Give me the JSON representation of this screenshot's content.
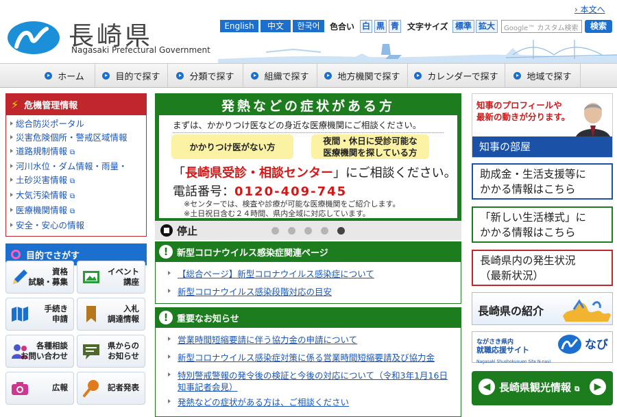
{
  "header": {
    "logo_jp": "長崎県",
    "logo_en": "Nagasaki Prefectural Government",
    "english_link": "本文へ",
    "lang_buttons": [
      "English",
      "中文",
      "한국어"
    ],
    "color_label": "色合い",
    "color_buttons": [
      "白",
      "黒",
      "青"
    ],
    "size_label": "文字サイズ",
    "size_buttons": [
      "標準",
      "拡大"
    ],
    "search_placeholder": "Google™ カスタム検索",
    "search_button": "検索",
    "accent": "#1b6fce"
  },
  "nav": [
    "ホーム",
    "目的で探す",
    "分類で探す",
    "組織で探す",
    "地方機関で探す",
    "カレンダーで探す",
    "地域で探す"
  ],
  "crisis": {
    "title": "危機管理情報",
    "items": [
      "総合防災ポータル",
      "災害危険個所・警戒区域情報",
      "道路規制情報",
      "河川水位・ダム情報・雨量・",
      "土砂災害情報",
      "大気汚染情報",
      "医療機関情報",
      "安全・安心の情報"
    ],
    "color": "#c0272d"
  },
  "purpose": {
    "title": "目的でさがす",
    "buttons": [
      [
        "資格",
        "試験・募集"
      ],
      [
        "イベント",
        "講座"
      ],
      [
        "手続き",
        "申請"
      ],
      [
        "入札",
        "調達情報"
      ],
      [
        "各種相談",
        "お問い合わせ"
      ],
      [
        "県からの",
        "お知らせ"
      ],
      [
        "広報"
      ],
      [
        "記者発表"
      ]
    ]
  },
  "banner": {
    "title": "発熱などの症状がある方",
    "line1": "まずは、かかりつけ医などの身近な医療機関にご相談ください。",
    "box1": "かかりつけ医がない方",
    "box2a": "夜間・休日に受診可能な",
    "box2b": "医療機関を探している方",
    "center_open": "「",
    "center_name": "長崎県受診・相談センター",
    "center_rest": "」にご相談ください。",
    "tel_label": "電話番号：",
    "tel_number": "0120-409-745",
    "note1": "※センターでは、検査や診療が可能な医療機関をご紹介します。",
    "note2": "※土日祝日含む２４時間、県内全域に対応しています。",
    "color": "#1d7d1e"
  },
  "slider": {
    "stop_label": "停止",
    "dots": 5,
    "active_dot": 4
  },
  "covid": {
    "title": "新型コロナウイルス感染症関連ページ",
    "items": [
      "【総合ページ】新型コロナウイルス感染症について",
      "新型コロナウイルス感染段階対応の目安"
    ]
  },
  "notice": {
    "title": "重要なお知らせ",
    "items": [
      "営業時間短縮要請に伴う協力金の申請について",
      "新型コロナウイルス感染症対策に係る営業時間短縮要請及び協力金",
      "特別警戒警報の発令後の検証と今後の対応について（令和3年1月16日",
      "知事記者会見）",
      "発熱などの症状がある方は、ご相談ください"
    ]
  },
  "right": {
    "gov_red1": "知事のプロフィールや",
    "gov_red2": "最新の動きが分ります。",
    "gov_foot": "知事の部屋",
    "box1a": "助成金・生活支援等に",
    "box1b": "かかる情報はこちら",
    "box2a": "「新しい生活様式」に",
    "box2b": "かかる情報はこちら",
    "box3a": "長崎県内の発生状況",
    "box3b": "（最新状況）",
    "intro": "長崎県の紹介",
    "job_top": "ながさき県内",
    "job_main": "就職応援サイト",
    "job_brand": "なび",
    "job_en": "Nagasaki Shushokuouen Site N-navi",
    "tour": "長崎県観光情報",
    "color_blue": "#1b52a8",
    "color_green": "#1d7d1e",
    "color_red": "#c0272d"
  }
}
